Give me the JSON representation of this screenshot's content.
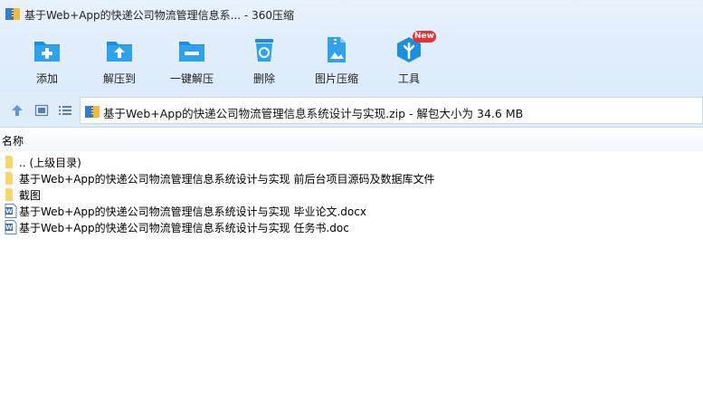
{
  "window": {
    "title": "基于Web+App的快递公司物流管理信息系... - 360压缩"
  },
  "toolbar": {
    "items": [
      {
        "label": "添加",
        "icon": "add-icon"
      },
      {
        "label": "解压到",
        "icon": "extract-to-icon"
      },
      {
        "label": "一键解压",
        "icon": "one-click-extract-icon"
      },
      {
        "label": "删除",
        "icon": "recycle-bin-icon"
      },
      {
        "label": "图片压缩",
        "icon": "image-compress-icon"
      },
      {
        "label": "工具",
        "icon": "tools-icon",
        "badge": "New"
      }
    ]
  },
  "address": {
    "text": "基于Web+App的快递公司物流管理信息系统设计与实现.zip - 解包大小为 34.6 MB"
  },
  "list": {
    "column_name": "名称",
    "items": [
      {
        "name": ".. (上级目录)",
        "type": "folder"
      },
      {
        "name": "基于Web+App的快递公司物流管理信息系统设计与实现 前后台项目源码及数据库文件",
        "type": "folder"
      },
      {
        "name": "截图",
        "type": "folder"
      },
      {
        "name": "基于Web+App的快递公司物流管理信息系统设计与实现 毕业论文.docx",
        "type": "word"
      },
      {
        "name": "基于Web+App的快递公司物流管理信息系统设计与实现 任务书.doc",
        "type": "word"
      }
    ]
  },
  "colors": {
    "toolbar_blue": "#1a8fe0",
    "badge_red": "#e8322f",
    "folder_yellow": "#f5c842"
  }
}
